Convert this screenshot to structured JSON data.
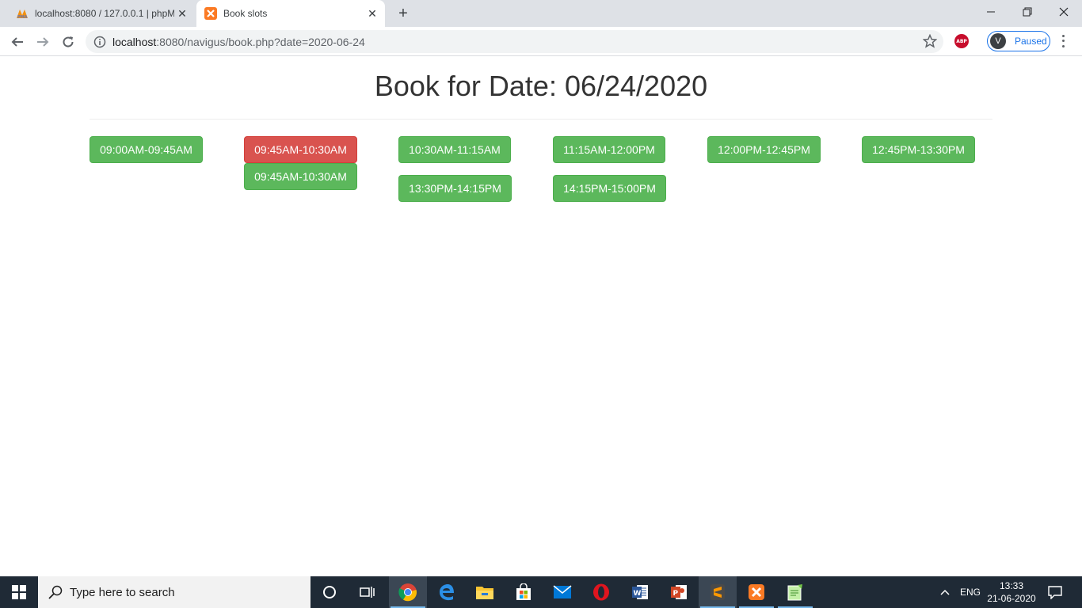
{
  "browser": {
    "tabs": [
      {
        "title": "localhost:8080 / 127.0.0.1 | phpMyAdmin",
        "active": false
      },
      {
        "title": "Book slots",
        "active": true
      }
    ],
    "url_host": "localhost",
    "url_rest": ":8080/navigus/book.php?date=2020-06-24",
    "abp_label": "ABP",
    "profile_initial": "V",
    "profile_status": "Paused"
  },
  "page": {
    "title": "Book for Date: 06/24/2020",
    "slots": [
      {
        "label": "09:00AM-09:45AM",
        "status": "available",
        "color": "#5cb85c"
      },
      {
        "label": "09:45AM-10:30AM",
        "status": "booked",
        "color": "#d9534f"
      },
      {
        "label": "09:45AM-10:30AM",
        "status": "available",
        "color": "#5cb85c"
      },
      {
        "label": "10:30AM-11:15AM",
        "status": "available",
        "color": "#5cb85c"
      },
      {
        "label": "13:30PM-14:15PM",
        "status": "available",
        "color": "#5cb85c"
      },
      {
        "label": "11:15AM-12:00PM",
        "status": "available",
        "color": "#5cb85c"
      },
      {
        "label": "14:15PM-15:00PM",
        "status": "available",
        "color": "#5cb85c"
      },
      {
        "label": "12:00PM-12:45PM",
        "status": "available",
        "color": "#5cb85c"
      },
      {
        "label": "12:45PM-13:30PM",
        "status": "available",
        "color": "#5cb85c"
      }
    ]
  },
  "taskbar": {
    "search_placeholder": "Type here to search",
    "apps": [
      "cortana-icon",
      "task-view-icon",
      "chrome-icon",
      "edge-icon",
      "file-explorer-icon",
      "store-icon",
      "mail-icon",
      "opera-icon",
      "word-icon",
      "powerpoint-icon",
      "sublime-icon",
      "xampp-icon",
      "notepad-icon"
    ],
    "language": "ENG",
    "time": "13:33",
    "date": "21-06-2020"
  }
}
